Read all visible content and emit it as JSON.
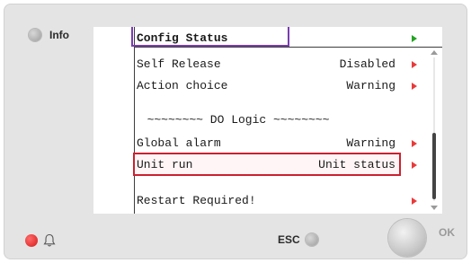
{
  "device": {
    "info_label": "Info",
    "esc_label": "ESC",
    "ok_label": "OK"
  },
  "screen": {
    "title": "Config Status",
    "rows": [
      {
        "label": "Self Release",
        "value": "Disabled"
      },
      {
        "label": "Action choice",
        "value": "Warning"
      },
      {
        "label": "~~~~~~~~ DO Logic ~~~~~~~~",
        "value": ""
      },
      {
        "label": "Global alarm",
        "value": "Warning"
      },
      {
        "label": "Unit run",
        "value": "Unit status"
      },
      {
        "label": "Restart Required!",
        "value": ""
      }
    ]
  },
  "colors": {
    "arrow_red": "#e83a3a",
    "arrow_green": "#23a323",
    "title_highlight": "#7a3db0",
    "selection_highlight": "#cc2030"
  }
}
